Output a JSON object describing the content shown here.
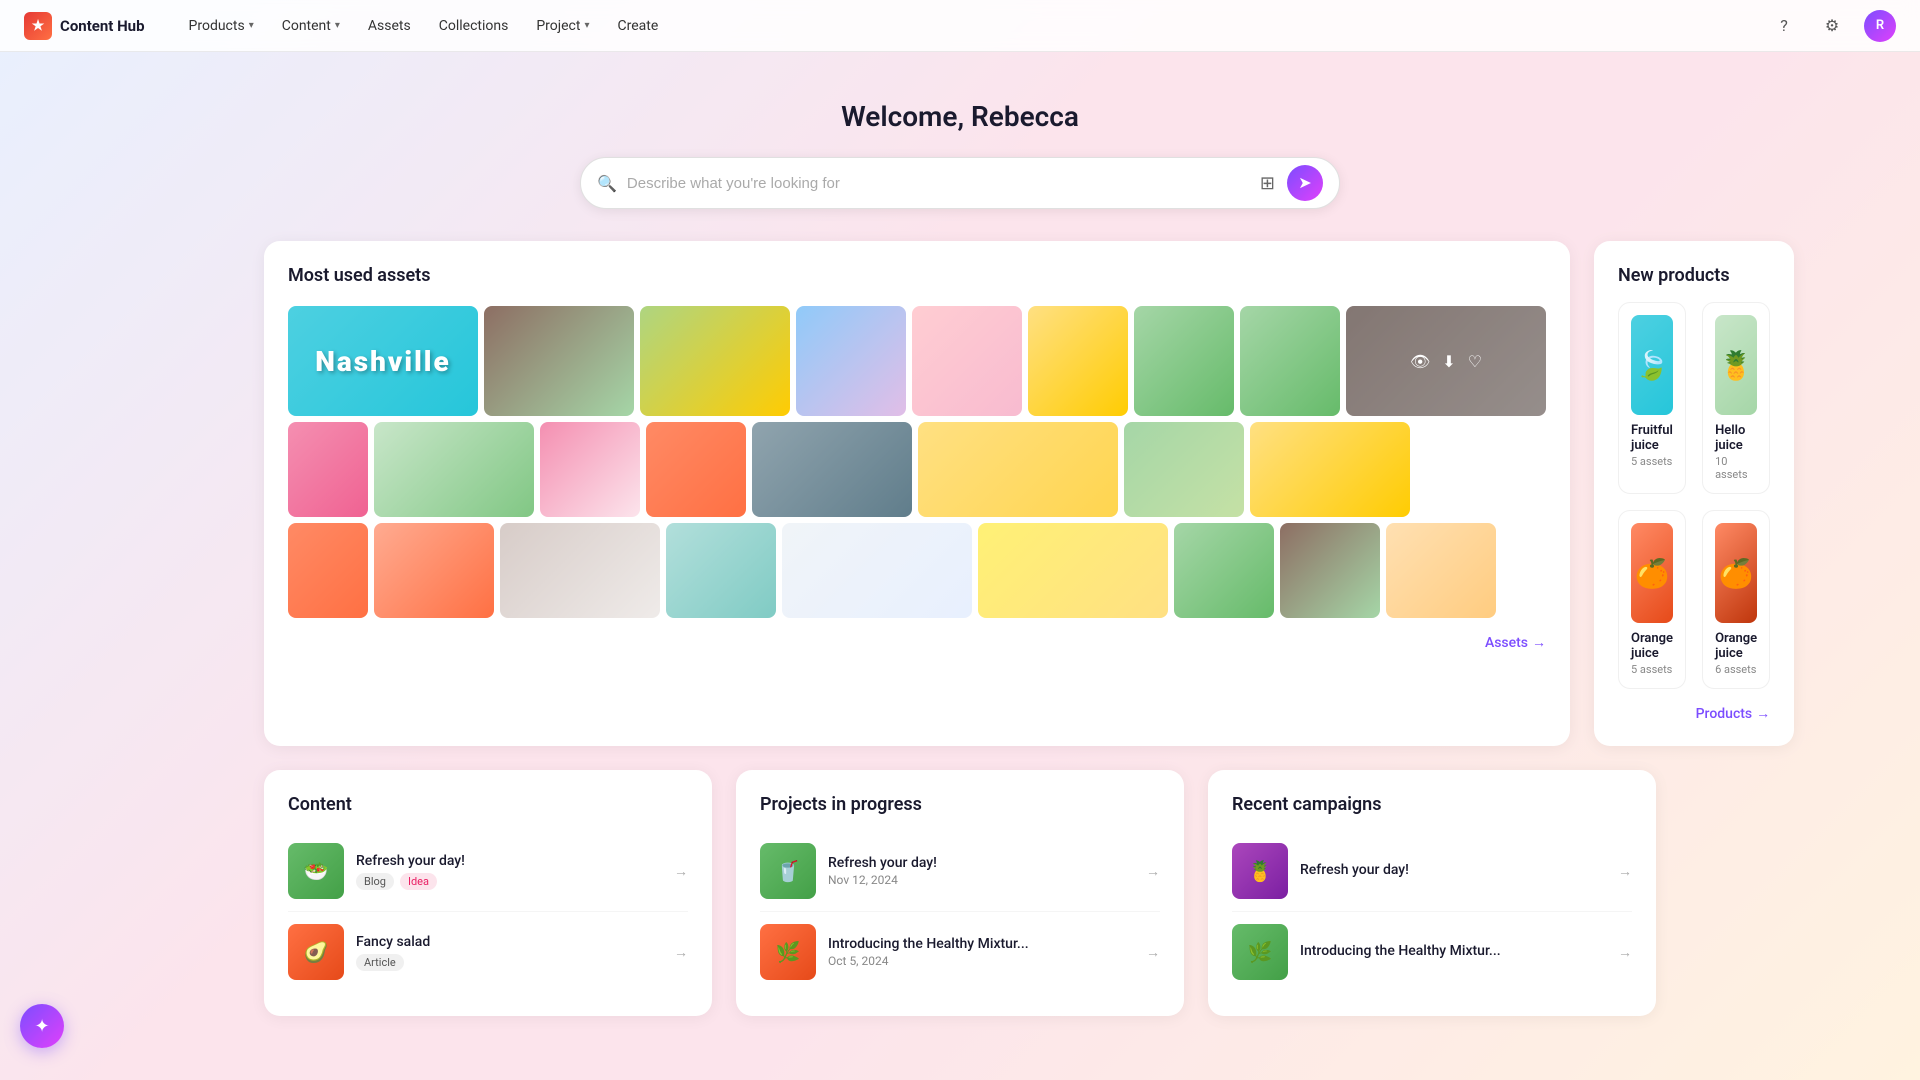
{
  "brand": {
    "name": "Content Hub",
    "icon": "★"
  },
  "nav": {
    "items": [
      {
        "label": "Products",
        "hasDropdown": true
      },
      {
        "label": "Content",
        "hasDropdown": true
      },
      {
        "label": "Assets",
        "hasDropdown": false
      },
      {
        "label": "Collections",
        "hasDropdown": false
      },
      {
        "label": "Project",
        "hasDropdown": true
      },
      {
        "label": "Create",
        "hasDropdown": false
      }
    ]
  },
  "hero": {
    "title": "Welcome, Rebecca",
    "search_placeholder": "Describe what you're looking for"
  },
  "assets_section": {
    "title": "Most used assets",
    "link_label": "Assets",
    "arrow": "→"
  },
  "products_section": {
    "title": "New products",
    "link_label": "Products",
    "arrow": "→",
    "items": [
      {
        "name": "Fruitful juice",
        "count": "5 assets",
        "emoji": "🍃"
      },
      {
        "name": "Hello juice",
        "count": "10 assets",
        "emoji": "🍍"
      },
      {
        "name": "Orange juice",
        "count": "5 assets",
        "emoji": "🍊"
      },
      {
        "name": "Orange juice",
        "count": "6 assets",
        "emoji": "🍊"
      }
    ]
  },
  "content_section": {
    "title": "Content",
    "items": [
      {
        "name": "Refresh your day!",
        "tags": [
          "Blog",
          "Idea"
        ],
        "emoji": "🥗"
      },
      {
        "name": "Fancy salad",
        "tags": [
          "Article"
        ],
        "emoji": "🥑"
      }
    ]
  },
  "projects_section": {
    "title": "Projects in progress",
    "items": [
      {
        "name": "Refresh your day!",
        "date": "Nov 12, 2024",
        "emoji": "🥤"
      },
      {
        "name": "Introducing the Healthy Mixtur...",
        "date": "Oct 5, 2024",
        "emoji": "🌿"
      }
    ]
  },
  "campaigns_section": {
    "title": "Recent campaigns",
    "items": [
      {
        "name": "Refresh your day!",
        "emoji": "🍍"
      },
      {
        "name": "Introducing the Healthy Mixtur...",
        "emoji": "🌿"
      }
    ]
  },
  "fab": {
    "icon": "✦"
  }
}
